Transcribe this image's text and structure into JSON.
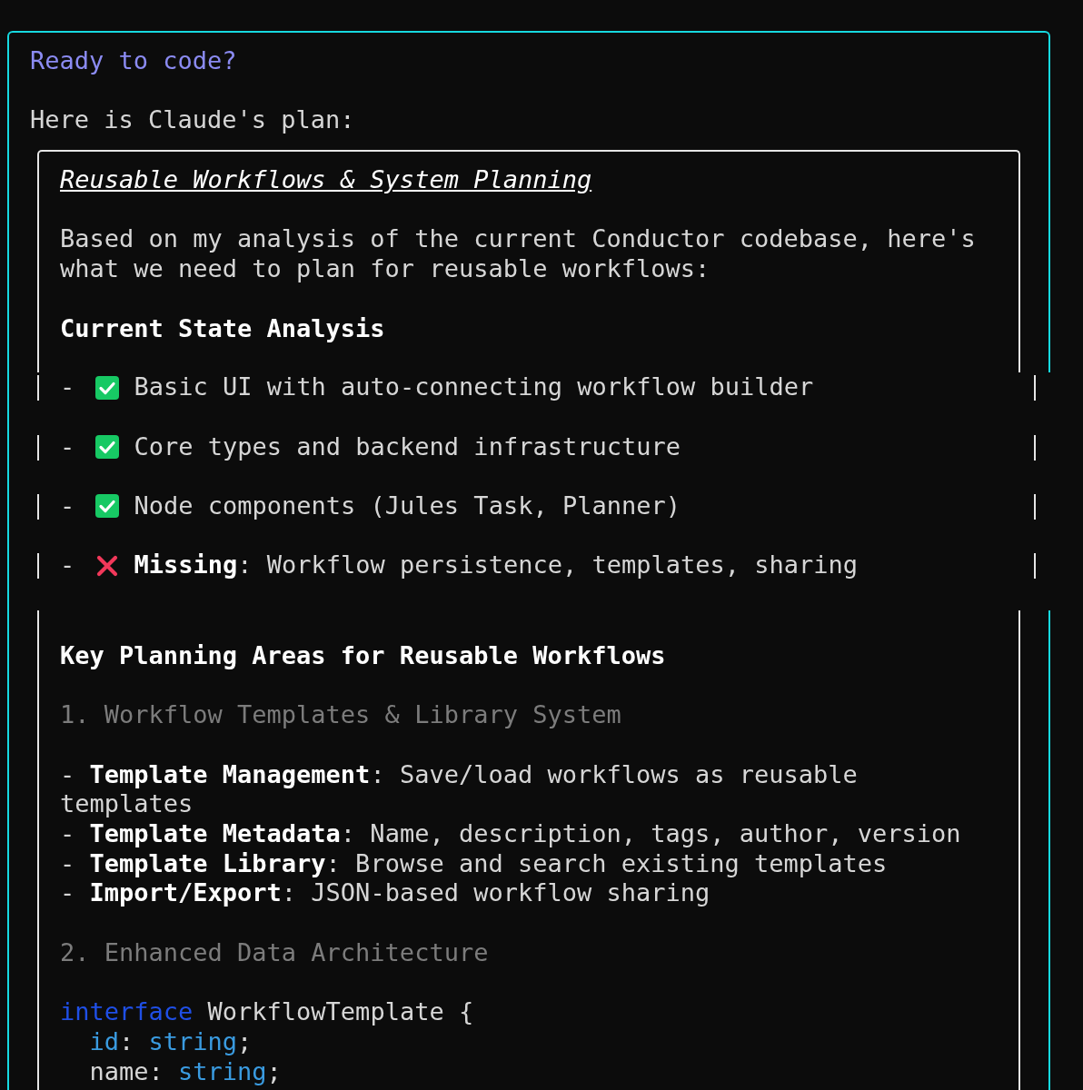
{
  "prompt": {
    "title": "Ready to code?",
    "intro": "Here is Claude's plan:"
  },
  "plan": {
    "title": "Reusable Workflows & System Planning",
    "paragraph": "Based on my analysis of the current Conductor codebase, here's what we need to plan for reusable workflows:",
    "heading": "Current State Analysis",
    "status_items": [
      {
        "bullet": "-",
        "kind": "done",
        "text": "Basic UI with auto-connecting workflow builder"
      },
      {
        "bullet": "-",
        "kind": "done",
        "text": "Core types and backend infrastructure"
      },
      {
        "bullet": "-",
        "kind": "done",
        "text": "Node components (Jules Task, Planner)"
      },
      {
        "bullet": "-",
        "kind": "missing",
        "text": "**Missing**: Workflow persistence, templates, sharing"
      }
    ],
    "blocks": [
      {
        "kind": "heading",
        "text": "Key Planning Areas for Reusable Workflows"
      },
      {
        "kind": "numbered_heading",
        "text": "1. Workflow Templates & Library System"
      },
      {
        "kind": "bullets",
        "items": [
          "- **Template Management**: Save/load workflows as reusable templates",
          "- **Template Metadata**: Name, description, tags, author, version",
          "- **Template Library**: Browse and search existing templates",
          "- **Import/Export**: JSON-based workflow sharing"
        ]
      },
      {
        "kind": "numbered_heading",
        "text": "2. Enhanced Data Architecture"
      },
      {
        "kind": "code",
        "lines": [
          {
            "tokens": [
              {
                "kind": "keyword",
                "text": "interface"
              },
              {
                "kind": "plain",
                "text": " WorkflowTemplate {"
              }
            ],
            "children": [
              {
                "tokens": [
                  {
                    "kind": "type",
                    "text": "id"
                  },
                  {
                    "kind": "plain",
                    "text": ": "
                  },
                  {
                    "kind": "type",
                    "text": "string"
                  },
                  {
                    "kind": "plain",
                    "text": ";"
                  }
                ]
              },
              {
                "tokens": [
                  {
                    "kind": "plain",
                    "text": "name: "
                  },
                  {
                    "kind": "type",
                    "text": "string"
                  },
                  {
                    "kind": "plain",
                    "text": ";"
                  }
                ]
              }
            ]
          }
        ]
      }
    ]
  }
}
